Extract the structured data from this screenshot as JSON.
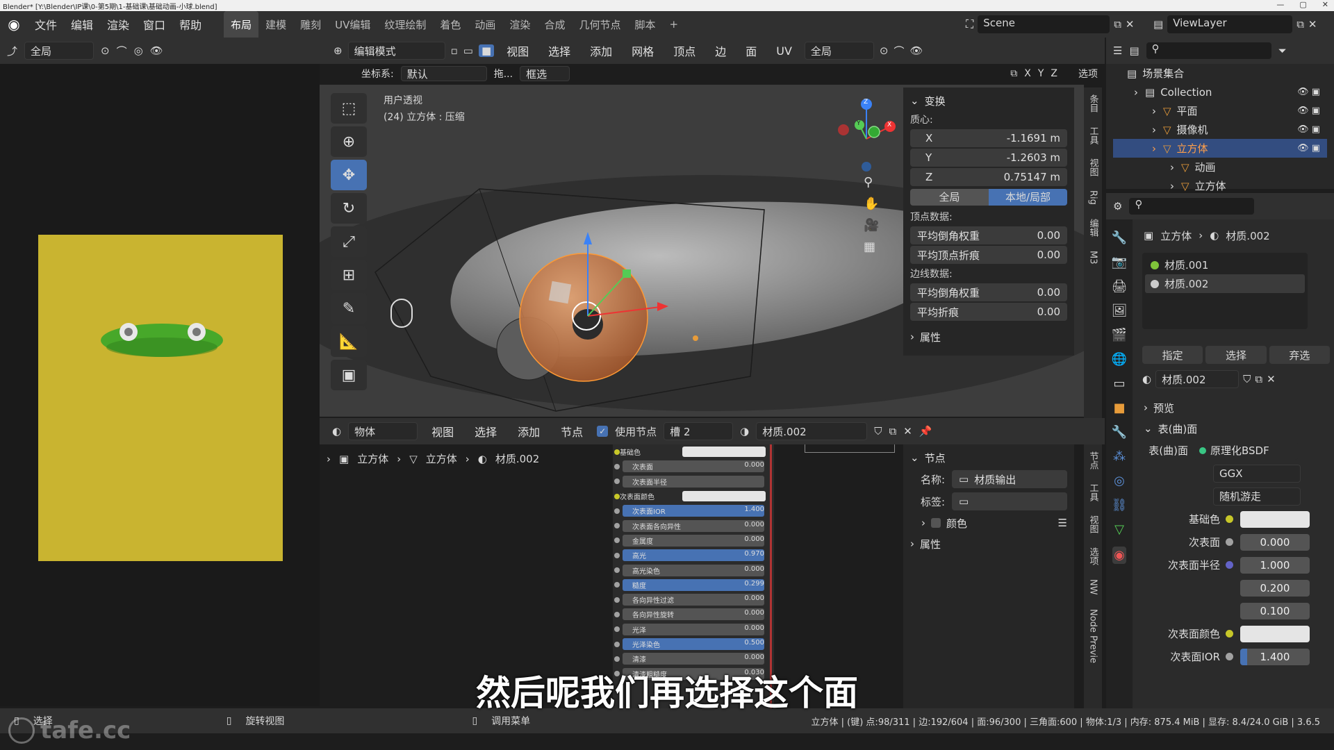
{
  "window": {
    "title": "Blender* [Y:\\Blender\\IP课\\0-第5期\\1-基础课\\基础动画-小球.blend]",
    "controls": [
      "—",
      "▢",
      "✕"
    ]
  },
  "topbar": {
    "menus": [
      "文件",
      "编辑",
      "渲染",
      "窗口",
      "帮助"
    ],
    "workspaces": [
      "布局",
      "建模",
      "雕刻",
      "UV编辑",
      "纹理绘制",
      "着色",
      "动画",
      "渲染",
      "合成",
      "几何节点",
      "脚本"
    ],
    "active_workspace": "布局",
    "add_tab": "+",
    "scene": "Scene",
    "view_layer": "ViewLayer"
  },
  "left_editor": {
    "transform_space": "全局"
  },
  "viewport": {
    "mode": "编辑模式",
    "menus": [
      "视图",
      "选择",
      "添加",
      "网格",
      "顶点",
      "边",
      "面",
      "UV"
    ],
    "transform_space": "全局",
    "coord_label": "坐标系:",
    "coord_value": "默认",
    "drag_label": "拖...",
    "select_mode": "框选",
    "axes": [
      "X",
      "Y",
      "Z"
    ],
    "options": "选项",
    "view_name": "用户透视",
    "object_info": "(24) 立方体 : 压缩",
    "gizmo": {
      "x": "X",
      "y": "Y",
      "z": "Z"
    }
  },
  "npanel_transform": {
    "header": "变换",
    "median_label": "质心:",
    "x_label": "X",
    "x_value": "-1.1691 m",
    "y_label": "Y",
    "y_value": "-1.2603 m",
    "z_label": "Z",
    "z_value": "0.75147 m",
    "toggle_global": "全局",
    "toggle_local": "本地/局部",
    "vertex_data": "顶点数据:",
    "v_bevel_label": "平均倒角权重",
    "v_bevel_value": "0.00",
    "v_crease_label": "平均顶点折痕",
    "v_crease_value": "0.00",
    "edge_data": "边线数据:",
    "e_bevel_label": "平均倒角权重",
    "e_bevel_value": "0.00",
    "e_crease_label": "平均折痕",
    "e_crease_value": "0.00",
    "properties": "属性"
  },
  "npanel_tabs_top": [
    "条目",
    "工具",
    "视图",
    "Rig",
    "编辑",
    "M3"
  ],
  "node_editor": {
    "type": "物体",
    "menus": [
      "视图",
      "选择",
      "添加",
      "节点"
    ],
    "use_nodes": "使用节点",
    "slot": "槽 2",
    "material": "材质.002",
    "breadcrumb": [
      "立方体",
      "立方体",
      "材质.002"
    ],
    "bsdf_rows": [
      {
        "label": "基础色",
        "value": "",
        "color": true
      },
      {
        "label": "次表面",
        "value": "0.000"
      },
      {
        "label": "次表面半径",
        "value": "",
        "dropdown": true
      },
      {
        "label": "次表面颜色",
        "value": "",
        "color": true
      },
      {
        "label": "次表面IOR",
        "value": "1.400",
        "hl": true
      },
      {
        "label": "次表面各向异性",
        "value": "0.000"
      },
      {
        "label": "金属度",
        "value": "0.000"
      },
      {
        "label": "高光",
        "value": "0.970",
        "hl": true
      },
      {
        "label": "高光染色",
        "value": "0.000"
      },
      {
        "label": "糙度",
        "value": "0.299",
        "hl": true
      },
      {
        "label": "各向异性过滤",
        "value": "0.000"
      },
      {
        "label": "各向异性旋转",
        "value": "0.000"
      },
      {
        "label": "光泽",
        "value": "0.000"
      },
      {
        "label": "光泽染色",
        "value": "0.500",
        "hl": true
      },
      {
        "label": "清漆",
        "value": "0.000"
      },
      {
        "label": "清漆粗糙度",
        "value": "0.030"
      }
    ],
    "node_panel": {
      "header": "节点",
      "name_label": "名称:",
      "name_value": "材质输出",
      "tag_label": "标签:",
      "tag_value": "",
      "color": "颜色",
      "properties": "属性"
    },
    "tabs": [
      "节点",
      "工具",
      "视图",
      "选项",
      "NW",
      "Node Previe"
    ]
  },
  "outliner": {
    "scene_collection": "场景集合",
    "items": [
      {
        "name": "Collection",
        "level": 0
      },
      {
        "name": "平面",
        "level": 1
      },
      {
        "name": "摄像机",
        "level": 1
      },
      {
        "name": "立方体",
        "level": 1,
        "selected": true
      },
      {
        "name": "动画",
        "level": 2
      },
      {
        "name": "立方体",
        "level": 2
      }
    ]
  },
  "properties": {
    "breadcrumb_obj": "立方体",
    "breadcrumb_mat": "材质.002",
    "slots": [
      "材质.001",
      "材质.002"
    ],
    "assign": "指定",
    "select": "选择",
    "deselect": "弃选",
    "material": "材质.002",
    "preview": "预览",
    "surface_section": "表(曲)面",
    "surface_label": "表(曲)面",
    "surface_value": "原理化BSDF",
    "distribution": "GGX",
    "subsurface_method": "随机游走",
    "rows": [
      {
        "label": "基础色",
        "value": "",
        "dot": "#c7c729",
        "color": true
      },
      {
        "label": "次表面",
        "value": "0.000",
        "dot": "#a1a1a1"
      },
      {
        "label": "次表面半径",
        "value": "1.000",
        "dot": "#6363c7"
      },
      {
        "label": "",
        "value": "0.200"
      },
      {
        "label": "",
        "value": "0.100"
      },
      {
        "label": "次表面颜色",
        "value": "",
        "dot": "#c7c729",
        "color": true
      },
      {
        "label": "次表面IOR",
        "value": "1.400",
        "dot": "#a1a1a1",
        "hl": true
      }
    ]
  },
  "statusbar": {
    "select": "选择",
    "rotate": "旋转视图",
    "menu": "调用菜单",
    "stats": "立方体 | (键) 点:98/311 | 边:192/604 | 面:96/300 | 三角面:600 | 物体:1/3 | 内存: 875.4 MiB | 显存: 8.4/24.0 GiB | 3.6.5"
  },
  "subtitle": "然后呢我们再选择这个面",
  "watermark": "tafe.cc"
}
